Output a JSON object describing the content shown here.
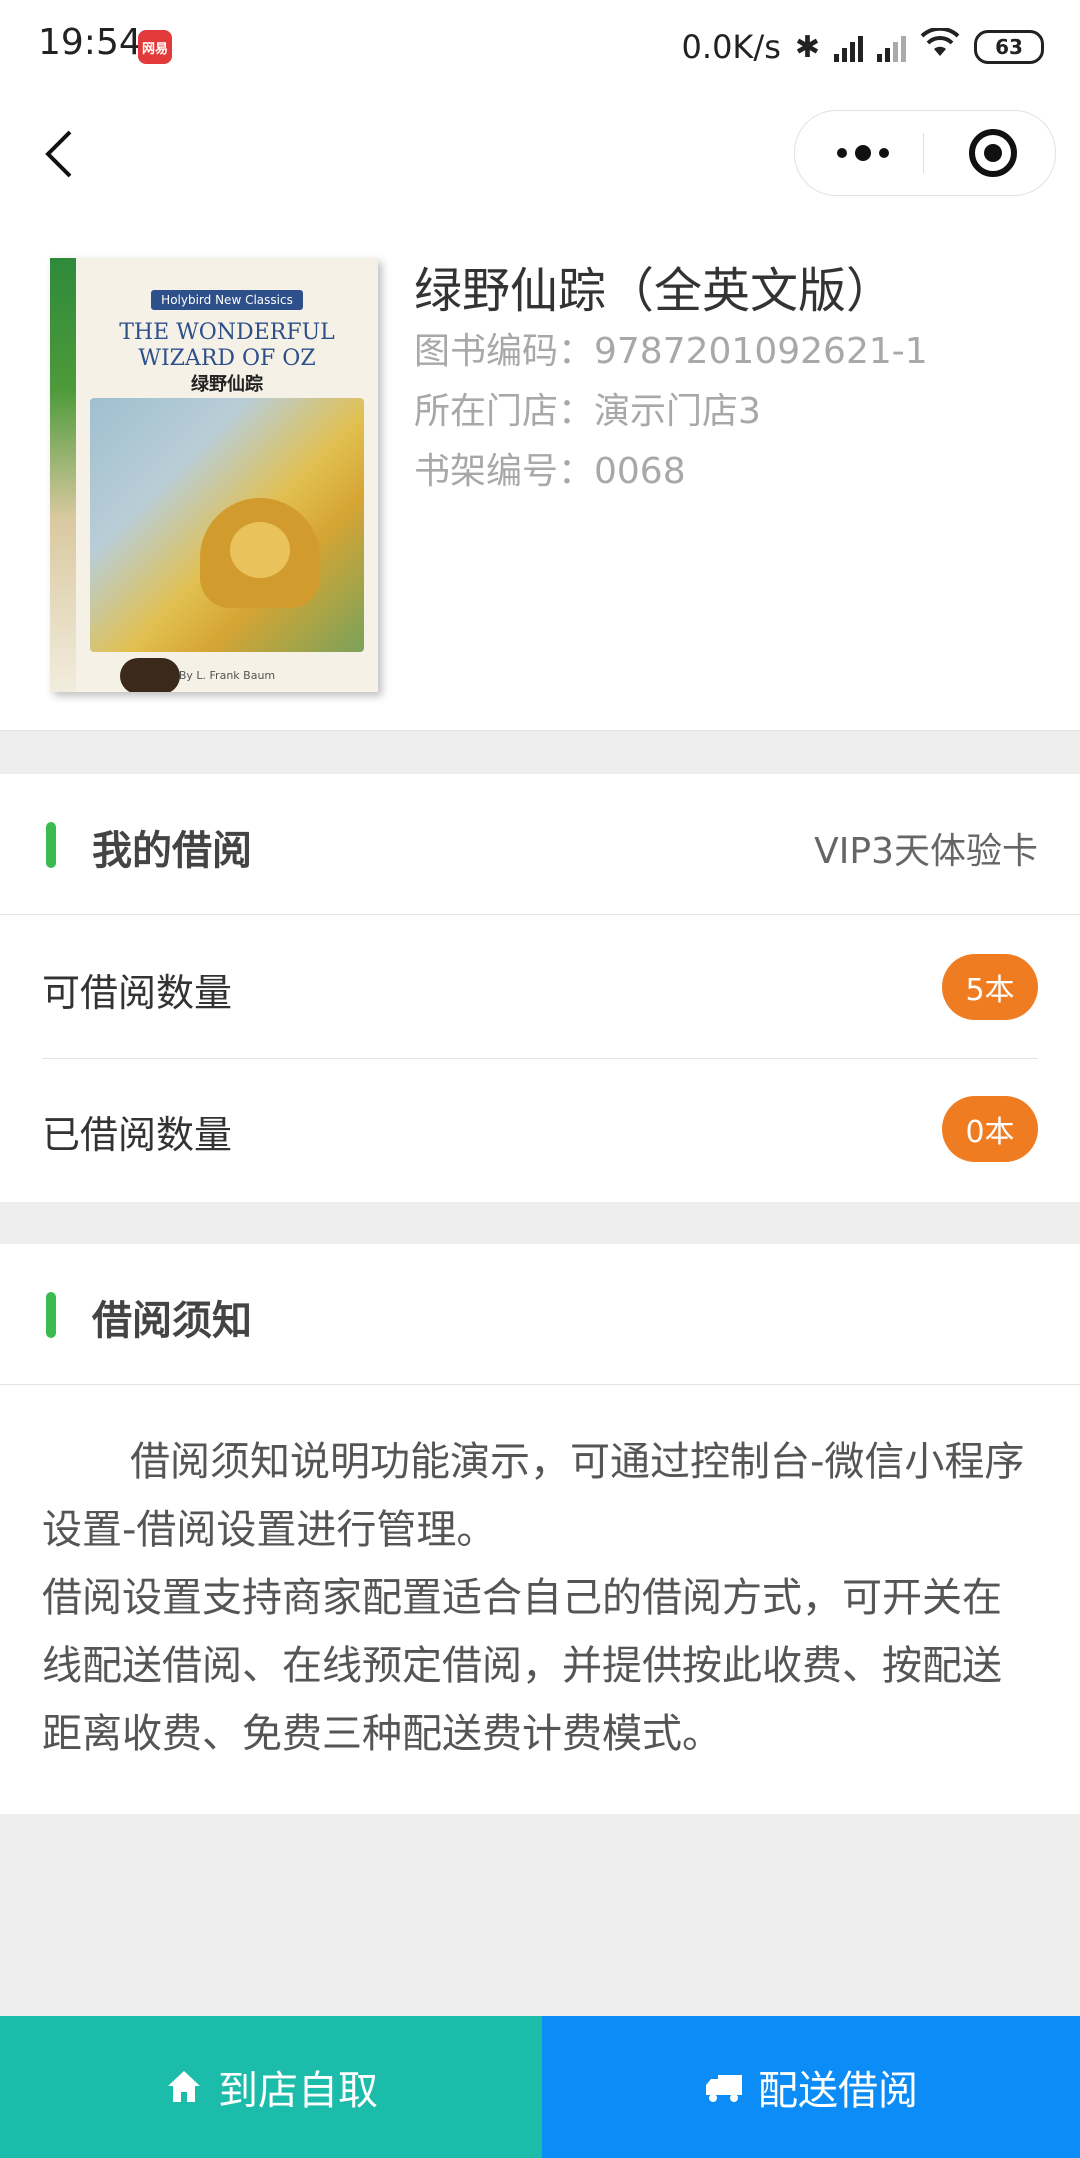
{
  "status_bar": {
    "time": "19:54",
    "app_badge": "网易",
    "network_speed": "0.0K/s",
    "battery": "63"
  },
  "book": {
    "title": "绿野仙踪（全英文版）",
    "code_line": "图书编码：9787201092621-1",
    "store_line": "所在门店：演示门店3",
    "shelf_line": "书架编号：0068",
    "cover": {
      "series": "Holybird New Classics",
      "title_en_1": "THE WONDERFUL",
      "title_en_2": "WIZARD OF OZ",
      "title_zh": "绿野仙踪",
      "author": "By L. Frank Baum"
    }
  },
  "borrow": {
    "title": "我的借阅",
    "card": "VIP3天体验卡",
    "rows": [
      {
        "label": "可借阅数量",
        "badge": "5本"
      },
      {
        "label": "已借阅数量",
        "badge": "0本"
      }
    ]
  },
  "notice": {
    "title": "借阅须知",
    "para1": "借阅须知说明功能演示，可通过控制台-微信小程序设置-借阅设置进行管理。",
    "para2": "借阅设置支持商家配置适合自己的借阅方式，可开关在线配送借阅、在线预定借阅，并提供按此收费、按配送距离收费、免费三种配送费计费模式。"
  },
  "actions": {
    "pickup_label": "到店自取",
    "delivery_label": "配送借阅"
  },
  "colors": {
    "accent_green": "#3cba4f",
    "badge_orange": "#f07c21",
    "pickup_teal": "#1cbcaa",
    "delivery_blue": "#0b8cf6"
  }
}
